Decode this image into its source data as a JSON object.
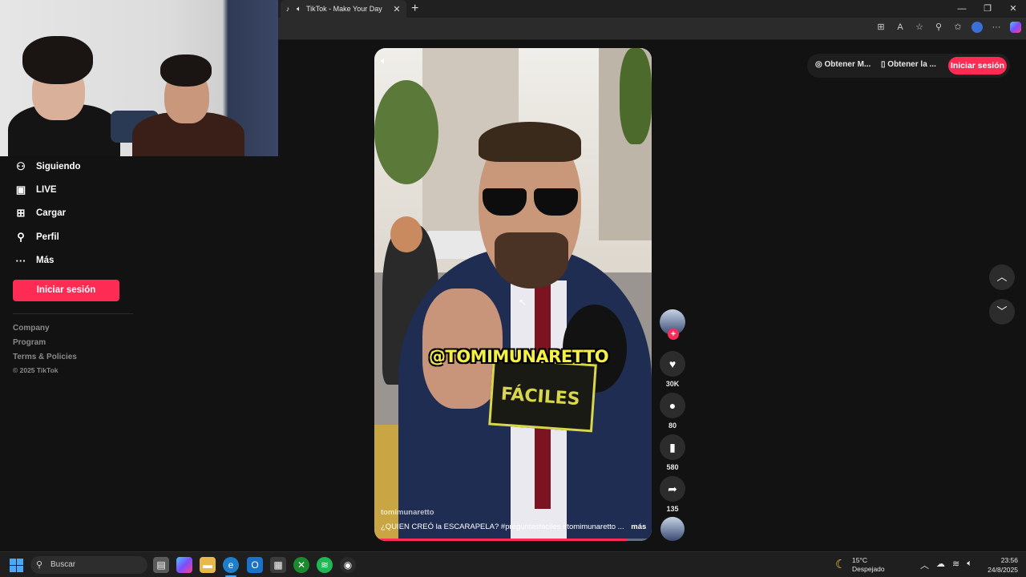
{
  "browser": {
    "tab_title": "TikTok - Make Your Day",
    "favicon": "tiktok-icon",
    "audio_icon": "speaker-icon",
    "new_tab": "+",
    "window_controls": [
      "—",
      "❐",
      "✕"
    ]
  },
  "sidebar": {
    "items": [
      {
        "label": "Siguiendo",
        "icon": "user-follow-icon",
        "glyph": "👤"
      },
      {
        "label": "LIVE",
        "icon": "live-tv-icon",
        "glyph": "📺"
      },
      {
        "label": "Cargar",
        "icon": "upload-plus-icon",
        "glyph": "⊞"
      },
      {
        "label": "Perfil",
        "icon": "profile-icon",
        "glyph": "👤"
      },
      {
        "label": "Más",
        "icon": "more-dots-icon",
        "glyph": "···"
      }
    ],
    "login_label": "Iniciar sesión",
    "footer_links": [
      "Company",
      "Program",
      "Terms & Policies"
    ],
    "copyright": "© 2025 TikTok"
  },
  "video": {
    "overlay_tag": "@TOMIMUNARETTO",
    "cube_text": "FÁCILES",
    "author": "tomimunaretto",
    "caption": "¿QUIEN CREÓ la ESCARAPELA? #preguntasfáciles #tomimunaretto ...",
    "more_label": "más",
    "progress": 0.91
  },
  "actions": {
    "like_count": "30K",
    "comment_count": "80",
    "save_count": "580",
    "share_count": "135",
    "follow_plus": "+"
  },
  "topbar": {
    "get_app_1": "Obtener M...",
    "get_app_2": "Obtener la ...",
    "login_label": "Iniciar sesión"
  },
  "taskbar": {
    "search_placeholder": "Buscar",
    "weather_temp": "15°C",
    "weather_desc": "Despejado",
    "time": "23:56",
    "date": "24/8/2025"
  },
  "colors": {
    "accent": "#fe2c55",
    "background": "#121212",
    "overlay_text": "#f6ef44"
  }
}
